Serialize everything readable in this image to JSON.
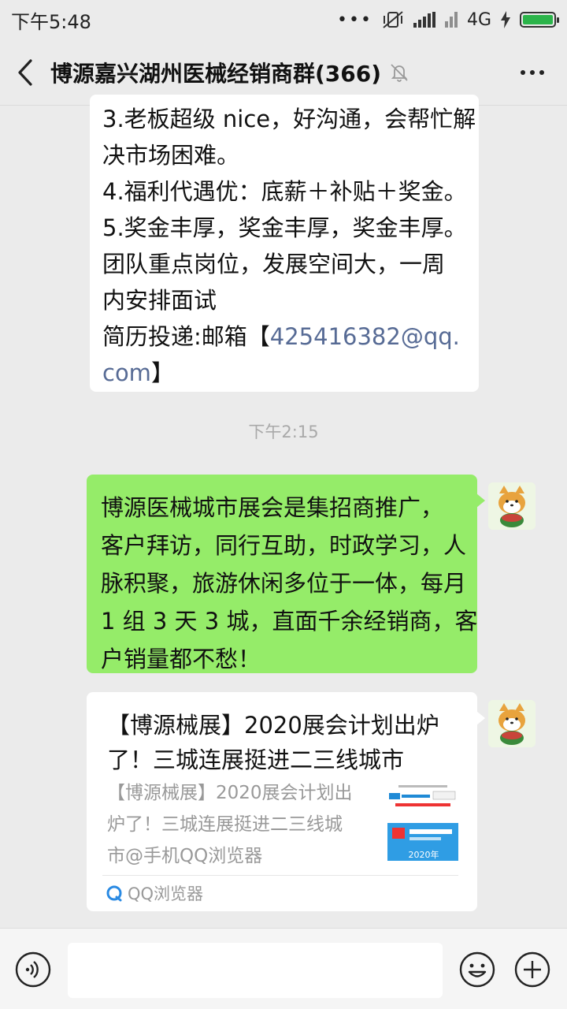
{
  "status_bar": {
    "time": "下午5:48",
    "network": "4G"
  },
  "header": {
    "title": "博源嘉兴湖州医械经销商群(366)",
    "back_icon": "chevron-left-icon",
    "mute_icon": "bell-off-icon",
    "more_icon": "more-horizontal-icon"
  },
  "messages": {
    "first": {
      "lines": [
        "3.老板超级 nice，好沟通，会帮忙解",
        "决市场困难。",
        "4.福利代遇优：底薪＋补贴＋奖金。",
        "5.奖金丰厚，奖金丰厚，奖金丰厚。",
        "团队重点岗位，发展空间大，一周",
        "内安排面试"
      ],
      "email_prefix": "简历投递:邮箱【",
      "email_part1": "425416382@qq.",
      "email_part2": "com",
      "email_suffix": "】"
    },
    "timestamp": "下午2:15",
    "sent": {
      "lines": [
        "博源医械城市展会是集招商推广，",
        "客户拜访，同行互助，时政学习，人",
        "脉积聚，旅游休闲多位于一体，每月",
        "1 组 3 天 3 城，直面千余经销商，客",
        "户销量都不愁！"
      ]
    },
    "card": {
      "title_lines": [
        "【博源械展】2020展会计划出炉",
        "了！三城连展挺进二三线城市"
      ],
      "desc_lines": [
        "【博源械展】2020展会计划出",
        "炉了！三城连展挺进二三线城",
        "市@手机QQ浏览器"
      ],
      "source": "QQ浏览器",
      "thumb_year": "2020年"
    }
  },
  "input_bar": {
    "voice_icon": "voice-icon",
    "emoji_icon": "emoji-icon",
    "plus_icon": "plus-circle-icon",
    "placeholder": ""
  },
  "colors": {
    "background": "#ebebeb",
    "sent_bubble": "#95ec69",
    "received_bubble": "#ffffff",
    "link": "#576b95",
    "battery": "#2bb44a"
  }
}
